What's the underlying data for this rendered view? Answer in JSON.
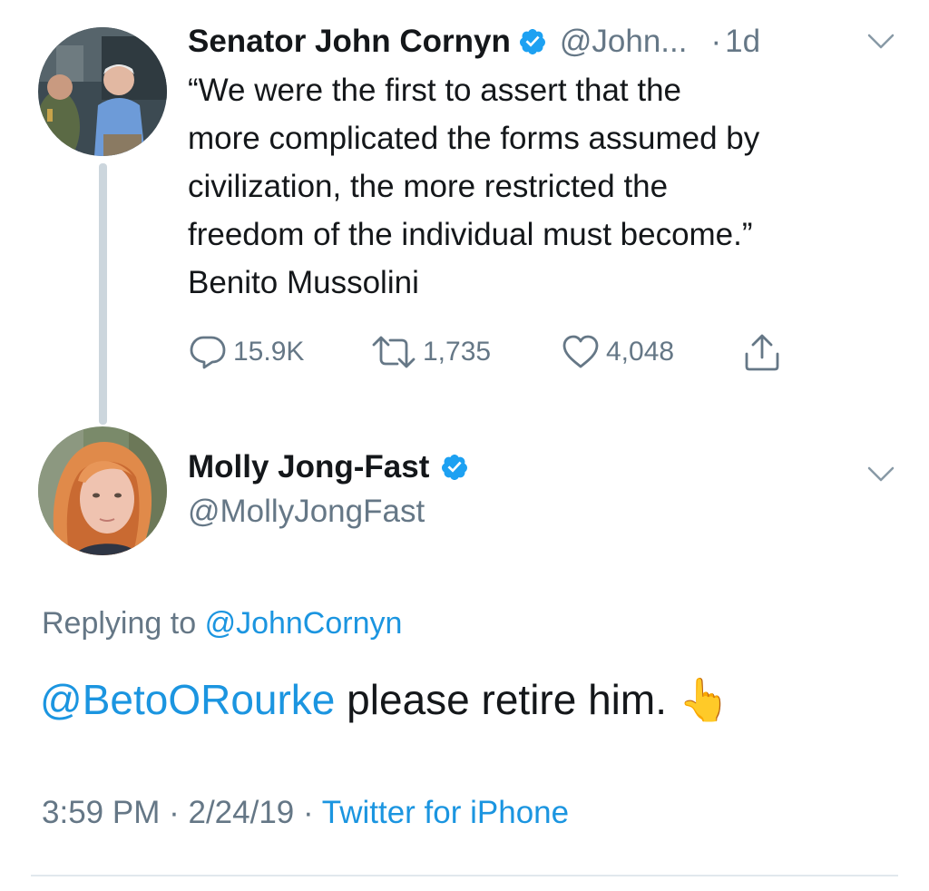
{
  "first_tweet": {
    "author_name": "Senator John Cornyn",
    "author_handle": "@John...",
    "time": "1d",
    "time_sep": "·",
    "text_lines": [
      "“We were the first to assert that the",
      "more complicated the forms assumed by",
      "civilization, the more restricted the",
      "freedom of the individual must become.”",
      "Benito Mussolini"
    ],
    "replies": "15.9K",
    "retweets": "1,735",
    "likes": "4,048"
  },
  "reply_tweet": {
    "author_name": "Molly Jong-Fast",
    "author_handle": "@MollyJongFast",
    "replying_prefix": "Replying to",
    "replying_to": "@JohnCornyn",
    "mention": "@BetoORourke",
    "text": " please retire him. 👆",
    "time": "3:59 PM",
    "date": "2/24/19",
    "sep": "·",
    "source": "Twitter for iPhone"
  },
  "colors": {
    "link": "#1b95e0",
    "verified": "#1da1f2",
    "muted": "#657786",
    "thread_line": "#ccd6dd"
  },
  "icons": [
    "verified-badge-icon",
    "chevron-down-icon",
    "reply-icon",
    "retweet-icon",
    "like-icon",
    "share-icon"
  ]
}
